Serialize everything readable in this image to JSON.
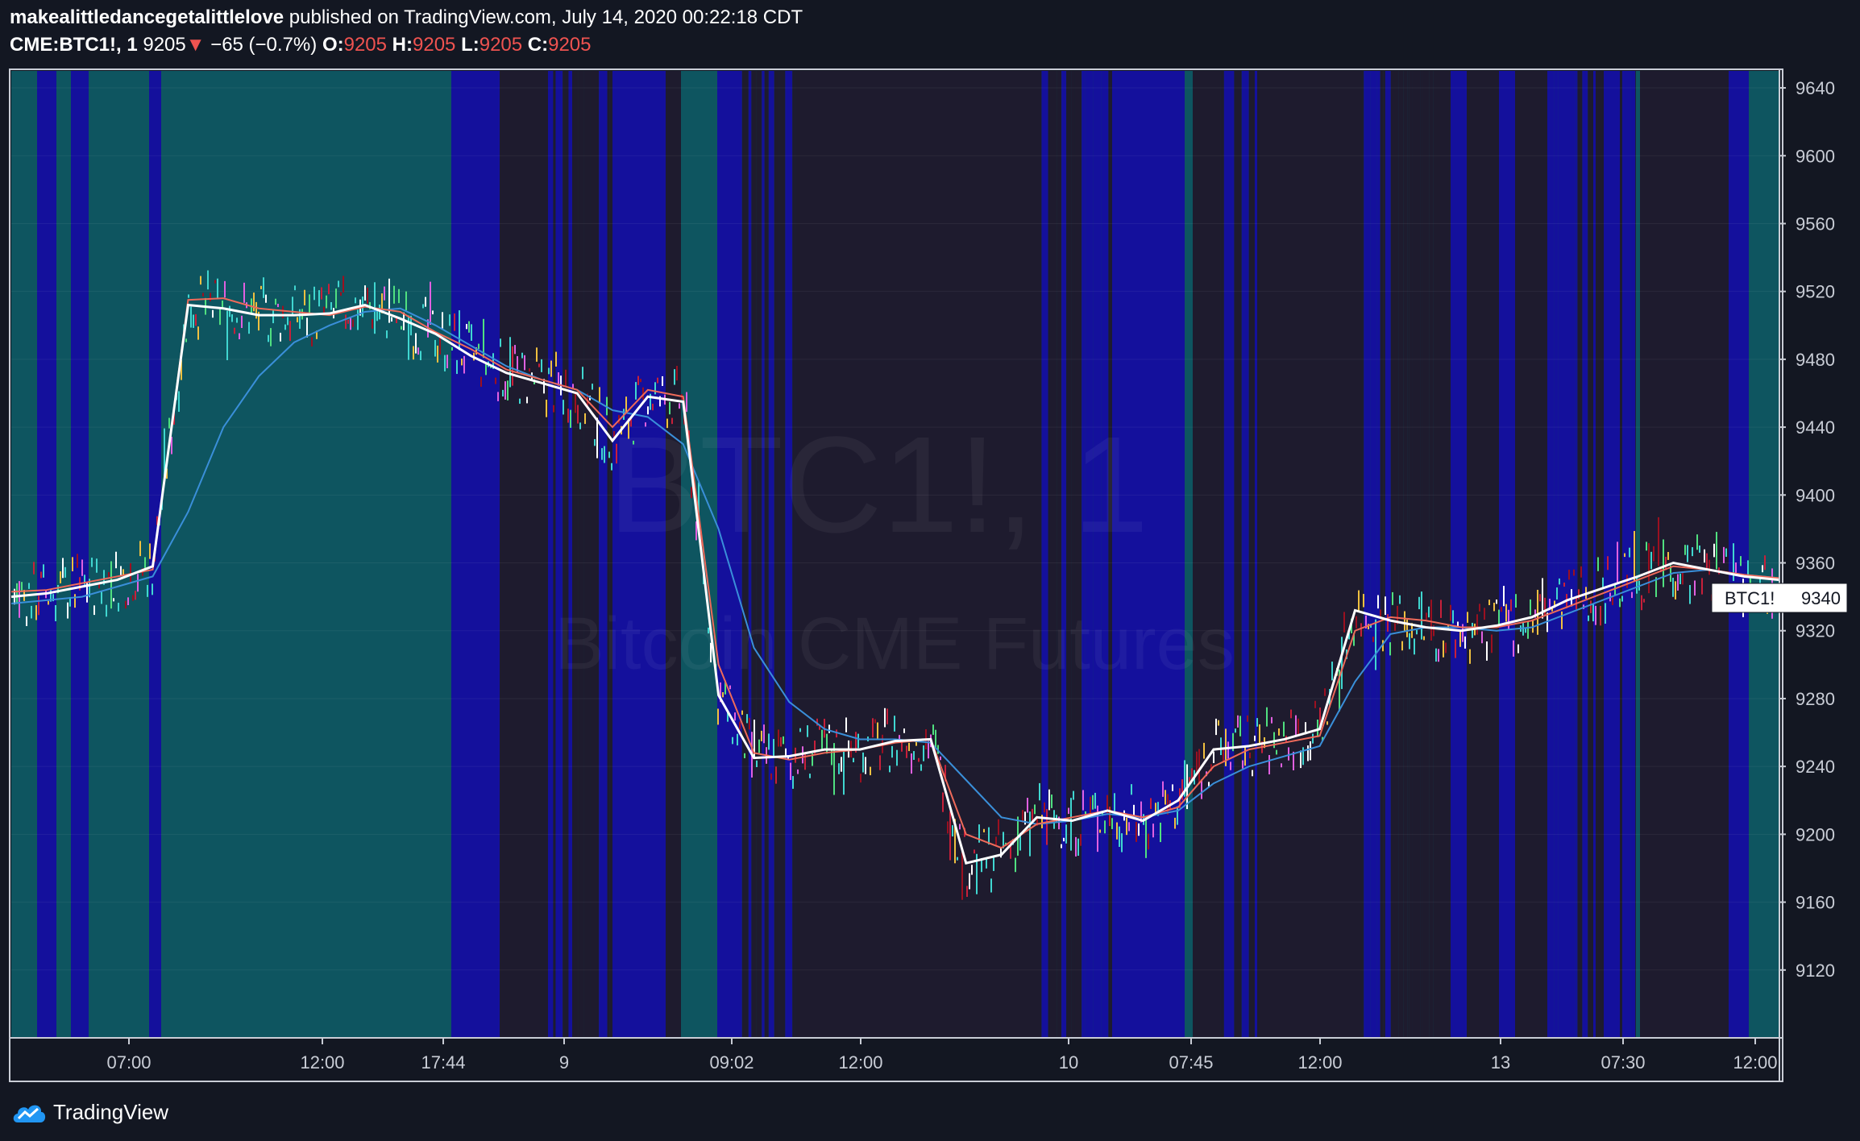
{
  "header": {
    "author": "makealittledancegetalittlelove",
    "published": " published on TradingView.com, July 14, 2020 00:22:18 CDT",
    "symbol": "CME:BTC1!, 1",
    "last": "9205",
    "arrow": "▼",
    "change": "−65 (−0.7%)",
    "o_label": "O:",
    "o": "9205",
    "h_label": "H:",
    "h": "9205",
    "l_label": "L:",
    "l": "9205",
    "c_label": "C:",
    "c": "9205"
  },
  "watermark": {
    "symbol": "BTC1!, 1",
    "name": "Bitcoin CME Futures"
  },
  "price_tag": {
    "label": "BTC1!",
    "value": "9340"
  },
  "brand": {
    "name": "TradingView"
  },
  "colors": {
    "background": "#131722",
    "teal_zone": "#0e5560",
    "blue_zone": "#14109c",
    "dark_zone": "#1e1b2e",
    "ema_white": "#ffffff",
    "ema_red": "#ef6a5a",
    "ema_blue": "#3a8fd9",
    "text_red": "#ef5350"
  },
  "chart_data": {
    "type": "line",
    "ylim": [
      9080,
      9650
    ],
    "y_ticks": [
      "9640",
      "9600",
      "9560",
      "9520",
      "9480",
      "9440",
      "9400",
      "9360",
      "9320",
      "9280",
      "9240",
      "9200",
      "9160",
      "9120"
    ],
    "x_ticks": [
      "07:00",
      "12:00",
      "17:44",
      "9",
      "09:02",
      "12:00",
      "10",
      "07:45",
      "12:00",
      "13",
      "07:30",
      "12:00"
    ],
    "x": [
      0,
      2,
      4,
      6,
      8,
      10,
      12,
      14,
      16,
      18,
      20,
      22,
      24,
      26,
      28,
      30,
      32,
      34,
      36,
      38,
      40,
      42,
      44,
      46,
      48,
      50,
      52,
      54,
      56,
      58,
      60,
      62,
      64,
      66,
      68,
      70,
      72,
      74,
      76,
      78,
      80,
      82,
      84,
      86,
      88,
      90,
      92,
      94,
      96,
      98,
      100
    ],
    "series": [
      {
        "name": "",
        "values": [
          9340,
          9342,
          9346,
          9350,
          9358,
          9512,
          9510,
          9506,
          9506,
          9507,
          9512,
          9504,
          9495,
          9482,
          9472,
          9466,
          9460,
          9432,
          9458,
          9455,
          9282,
          9245,
          9246,
          9250,
          9250,
          9255,
          9256,
          9183,
          9188,
          9210,
          9208,
          9214,
          9208,
          9220,
          9250,
          9252,
          9256,
          9262,
          9332,
          9326,
          9322,
          9320,
          9323,
          9328,
          9338,
          9345,
          9352,
          9360,
          9356,
          9352,
          9350
        ]
      },
      {
        "name": "",
        "values": [
          9343,
          9344,
          9348,
          9352,
          9356,
          9515,
          9516,
          9510,
          9508,
          9506,
          9511,
          9508,
          9496,
          9486,
          9474,
          9468,
          9462,
          9440,
          9462,
          9458,
          9300,
          9248,
          9244,
          9248,
          9250,
          9254,
          9256,
          9200,
          9192,
          9206,
          9210,
          9214,
          9210,
          9216,
          9240,
          9250,
          9254,
          9258,
          9320,
          9328,
          9326,
          9322,
          9322,
          9326,
          9334,
          9342,
          9350,
          9358,
          9356,
          9353,
          9351
        ]
      },
      {
        "name": "",
        "values": [
          9336,
          9338,
          9340,
          9346,
          9352,
          9390,
          9440,
          9470,
          9490,
          9500,
          9508,
          9510,
          9500,
          9488,
          9476,
          9468,
          9462,
          9450,
          9446,
          9430,
          9380,
          9310,
          9278,
          9262,
          9256,
          9256,
          9254,
          9232,
          9210,
          9206,
          9208,
          9212,
          9210,
          9214,
          9230,
          9240,
          9246,
          9252,
          9290,
          9318,
          9322,
          9322,
          9320,
          9322,
          9330,
          9338,
          9346,
          9354,
          9356,
          9353,
          9351
        ]
      }
    ]
  }
}
